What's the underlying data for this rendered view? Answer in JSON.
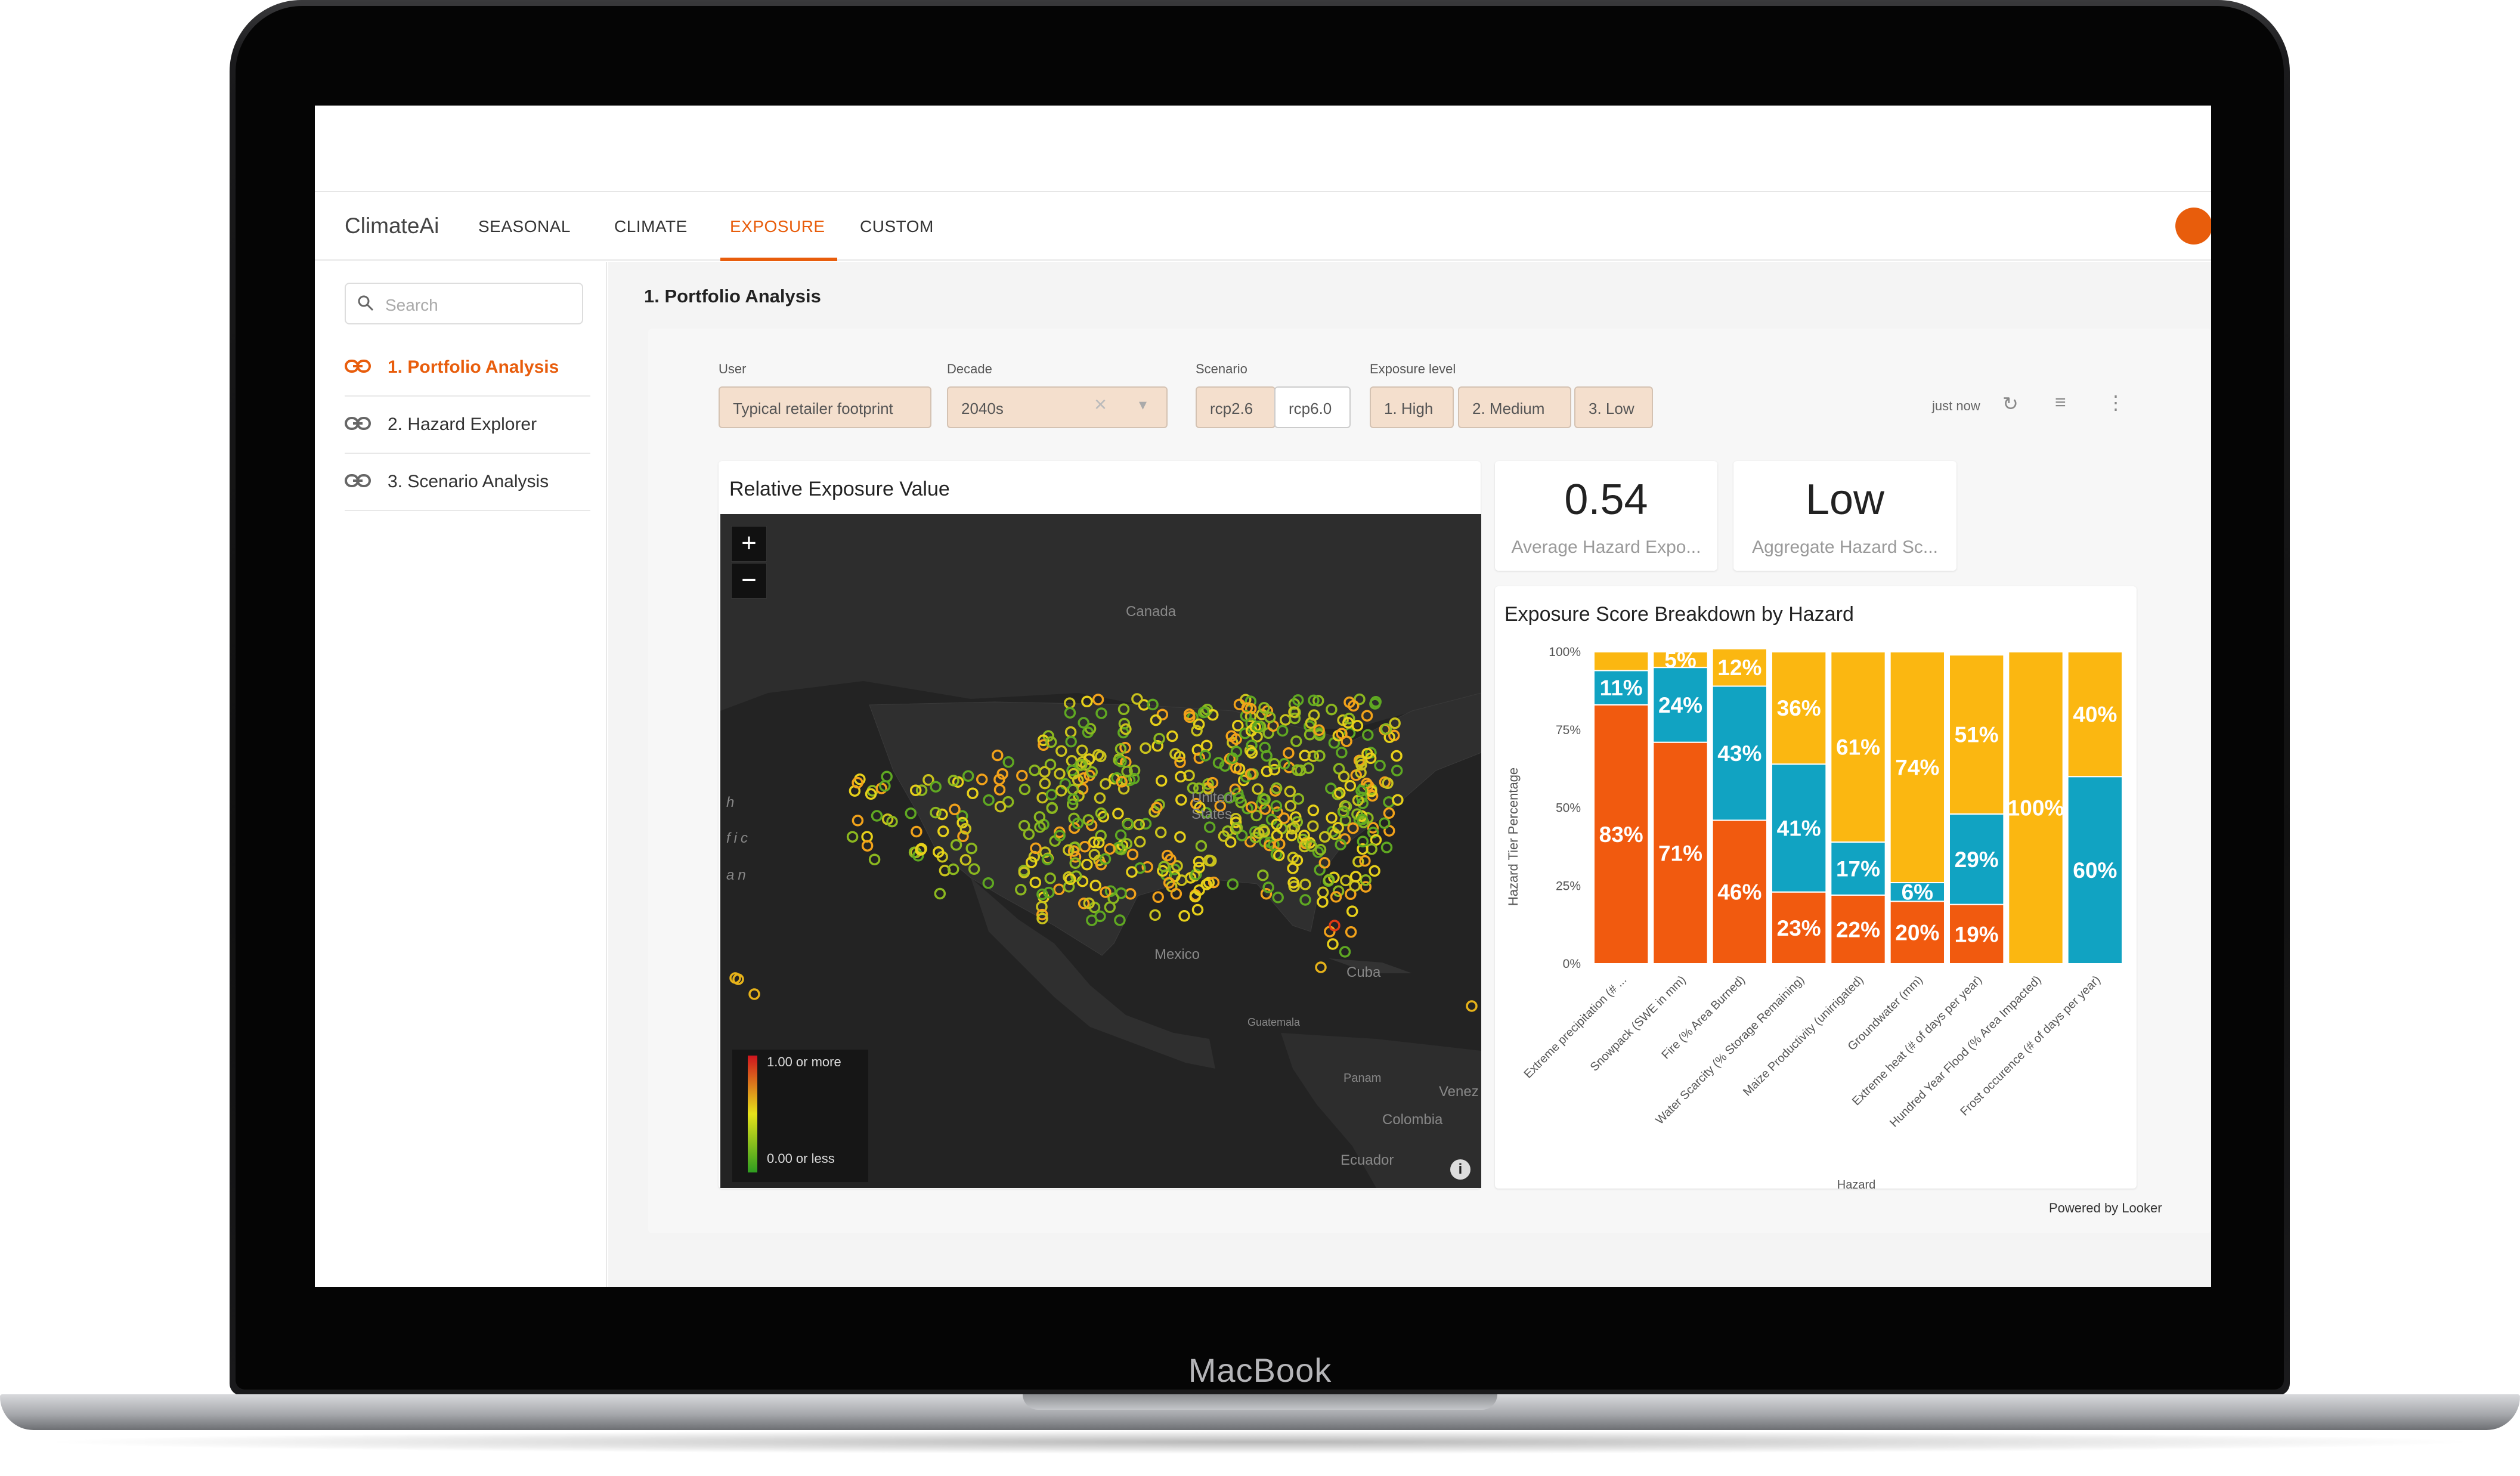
{
  "device": {
    "label": "MacBook"
  },
  "app": {
    "brand": "ClimateAi",
    "tabs": [
      {
        "label": "SEASONAL"
      },
      {
        "label": "CLIMATE"
      },
      {
        "label": "EXPOSURE"
      },
      {
        "label": "CUSTOM"
      }
    ],
    "active_tab": "EXPOSURE",
    "accent": "#e85d0c"
  },
  "sidebar": {
    "search_placeholder": "Search",
    "items": [
      {
        "label": "1. Portfolio Analysis",
        "active": true
      },
      {
        "label": "2. Hazard Explorer",
        "active": false
      },
      {
        "label": "3. Scenario Analysis",
        "active": false
      }
    ]
  },
  "page": {
    "title": "1. Portfolio Analysis"
  },
  "filters": {
    "user": {
      "label": "User",
      "value": "Typical retailer footprint"
    },
    "decade": {
      "label": "Decade",
      "value": "2040s"
    },
    "scenario": {
      "label": "Scenario",
      "options": [
        "rcp2.6",
        "rcp6.0"
      ],
      "selected": "rcp2.6"
    },
    "exposure": {
      "label": "Exposure level",
      "options": [
        "1. High",
        "2. Medium",
        "3. Low"
      ]
    }
  },
  "toolbar": {
    "status": "just now"
  },
  "map_card": {
    "title": "Relative Exposure Value",
    "labels": [
      "Canada",
      "United States",
      "Mexico",
      "Cuba",
      "Guatemala",
      "Colombia",
      "Venez",
      "Ecuador",
      "Panam",
      "h",
      "fic",
      "an"
    ],
    "legend": {
      "max": "1.00 or more",
      "min": "0.00 or less"
    },
    "zoom_in": "+",
    "zoom_out": "−",
    "info": "i"
  },
  "kpis": [
    {
      "value": "0.54",
      "caption": "Average Hazard Expo..."
    },
    {
      "value": "Low",
      "caption": "Aggregate Hazard Sc..."
    }
  ],
  "chart_data": {
    "type": "bar",
    "stacked": true,
    "title": "Exposure Score Breakdown by Hazard",
    "ylabel": "Hazard Tier Percentage",
    "xlabel": "Hazard",
    "ylim": [
      0,
      100
    ],
    "yticks": [
      "0%",
      "25%",
      "50%",
      "75%",
      "100%"
    ],
    "categories": [
      "Extreme precipitation (# ...",
      "Snowpack (SWE in mm)",
      "Fire (% Area Burned)",
      "Water Scarcity (% Storage Remaining)",
      "Maize Productivity (unirrigated)",
      "Groundwater (mm)",
      "Extreme heat (# of days per year)",
      "Hundred Year Flood (% Area Impacted)",
      "Frost occurence (# of days per year)"
    ],
    "series": [
      {
        "color": "#f15a0f",
        "values": [
          83,
          71,
          46,
          23,
          22,
          20,
          19,
          0,
          0
        ],
        "labels": [
          "83%",
          "71%",
          "46%",
          "23%",
          "22%",
          "20%",
          "19%",
          "",
          ""
        ]
      },
      {
        "color": "#11a3c2",
        "values": [
          11,
          24,
          43,
          41,
          17,
          6,
          29,
          0,
          60
        ],
        "labels": [
          "11%",
          "24%",
          "43%",
          "41%",
          "17%",
          "6%",
          "29%",
          "",
          "60%"
        ]
      },
      {
        "color": "#fbb711",
        "values": [
          6,
          5,
          12,
          36,
          61,
          74,
          51,
          100,
          40
        ],
        "labels": [
          "",
          "5%",
          "12%",
          "36%",
          "61%",
          "74%",
          "51%",
          "100%",
          "40%"
        ]
      }
    ]
  },
  "footer": {
    "powered": "Powered by Looker"
  }
}
